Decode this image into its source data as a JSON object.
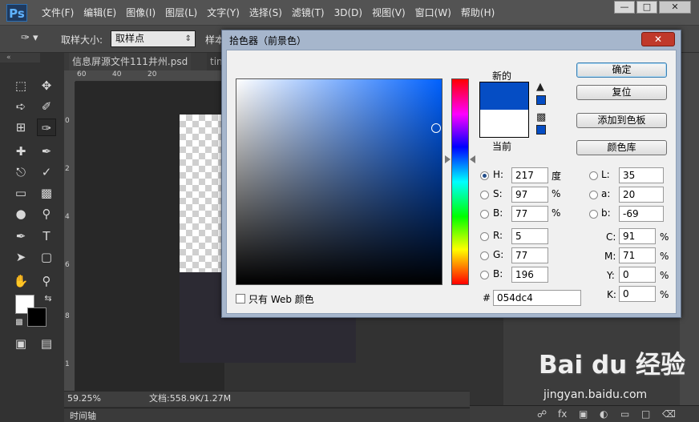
{
  "app": {
    "logo": "Ps"
  },
  "menu": [
    "文件(F)",
    "编辑(E)",
    "图像(I)",
    "图层(L)",
    "文字(Y)",
    "选择(S)",
    "滤镜(T)",
    "3D(D)",
    "视图(V)",
    "窗口(W)",
    "帮助(H)"
  ],
  "options": {
    "sample_size_label": "取样大小:",
    "sample_size_value": "取样点",
    "sample_label": "样本"
  },
  "tabs": [
    {
      "label": "信息屏源文件111井州.psd"
    },
    {
      "label": "tin"
    }
  ],
  "rulers": {
    "h": [
      "60",
      "40",
      "20"
    ],
    "v": [
      "0",
      "2",
      "4",
      "6",
      "8",
      "1",
      "0",
      "0",
      "1",
      "2",
      "1",
      "4",
      "1",
      "6",
      "1",
      "8",
      "1",
      "0",
      "0"
    ]
  },
  "status": {
    "zoom": "59.25%",
    "doc": "文档:558.9K/1.27M"
  },
  "timeline": {
    "label": "时间轴"
  },
  "colors": {
    "foreground": "#ffffff",
    "background": "#000000",
    "picked": "#054dc4",
    "current": "#ffffff"
  },
  "dialog": {
    "title": "拾色器（前景色）",
    "new_label": "新的",
    "current_label": "当前",
    "buttons": {
      "ok": "确定",
      "reset": "复位",
      "add_swatch": "添加到色板",
      "libraries": "颜色库"
    },
    "hsb": [
      {
        "label": "H:",
        "value": "217",
        "unit": "度",
        "selected": true
      },
      {
        "label": "S:",
        "value": "97",
        "unit": "%",
        "selected": false
      },
      {
        "label": "B:",
        "value": "77",
        "unit": "%",
        "selected": false
      }
    ],
    "rgb": [
      {
        "label": "R:",
        "value": "5"
      },
      {
        "label": "G:",
        "value": "77"
      },
      {
        "label": "B:",
        "value": "196"
      }
    ],
    "lab": [
      {
        "label": "L:",
        "value": "35"
      },
      {
        "label": "a:",
        "value": "20"
      },
      {
        "label": "b:",
        "value": "-69"
      }
    ],
    "cmyk": [
      {
        "label": "C:",
        "value": "91",
        "unit": "%"
      },
      {
        "label": "M:",
        "value": "71",
        "unit": "%"
      },
      {
        "label": "Y:",
        "value": "0",
        "unit": "%"
      },
      {
        "label": "K:",
        "value": "0",
        "unit": "%"
      }
    ],
    "web_only_label": "只有 Web 颜色",
    "hex_label": "#",
    "hex_value": "054dc4"
  },
  "watermark": {
    "brand": "Bai du 经验",
    "url": "jingyan.baidu.com"
  }
}
